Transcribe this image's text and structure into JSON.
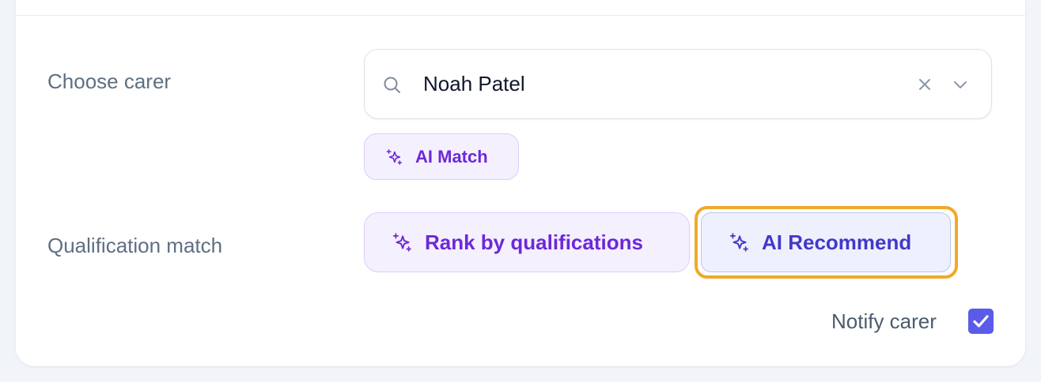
{
  "form": {
    "carer": {
      "label": "Choose carer",
      "value": "Noah Patel",
      "search_icon": "search-icon",
      "clear_icon": "close-icon",
      "dropdown_icon": "chevron-down-icon",
      "ai_match_label": "AI Match"
    },
    "qualification": {
      "label": "Qualification match",
      "rank_label": "Rank by qualifications",
      "recommend_label": "AI Recommend",
      "sparkle_icon": "sparkle-icon"
    },
    "notify": {
      "label": "Notify carer",
      "checked": true
    }
  },
  "colors": {
    "accent_purple": "#6d28d9",
    "accent_indigo": "#4338ca",
    "checkbox": "#5b5bea",
    "focus_ring": "#f0a92b"
  }
}
